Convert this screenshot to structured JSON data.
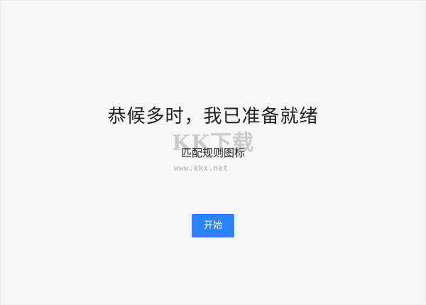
{
  "headline": "恭候多时，我已准备就绪",
  "subtitle": "匹配规则图标",
  "watermark": {
    "glyphs": "KK下载",
    "url": "www.kkx.net"
  },
  "start_button": {
    "label": "开始",
    "color": "#2d84f7"
  }
}
